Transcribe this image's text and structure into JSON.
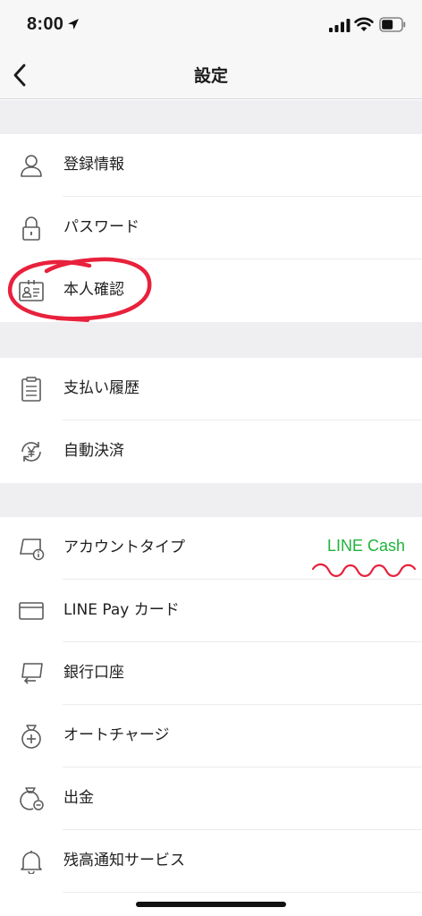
{
  "status_bar": {
    "time": "8:00"
  },
  "nav": {
    "title": "設定",
    "back_icon": "chevron-left-icon"
  },
  "sections": [
    {
      "items": [
        {
          "label": "登録情報",
          "icon": "person-icon"
        },
        {
          "label": "パスワード",
          "icon": "lock-icon"
        },
        {
          "label": "本人確認",
          "icon": "id-card-icon"
        }
      ]
    },
    {
      "items": [
        {
          "label": "支払い履歴",
          "icon": "clipboard-icon"
        },
        {
          "label": "自動決済",
          "icon": "yen-refresh-icon"
        }
      ]
    },
    {
      "items": [
        {
          "label": "アカウントタイプ",
          "icon": "account-info-icon",
          "value": "LINE Cash"
        },
        {
          "label": "LINE Pay カード",
          "icon": "card-icon"
        },
        {
          "label": "銀行口座",
          "icon": "bank-transfer-icon"
        },
        {
          "label": "オートチャージ",
          "icon": "money-bag-plus-icon"
        },
        {
          "label": "出金",
          "icon": "money-bag-minus-icon"
        },
        {
          "label": "残高通知サービス",
          "icon": "bell-icon"
        }
      ]
    }
  ],
  "colors": {
    "accent_green": "#1fb33a",
    "annotation_red": "#e8213c",
    "section_gap": "#efeff1"
  }
}
